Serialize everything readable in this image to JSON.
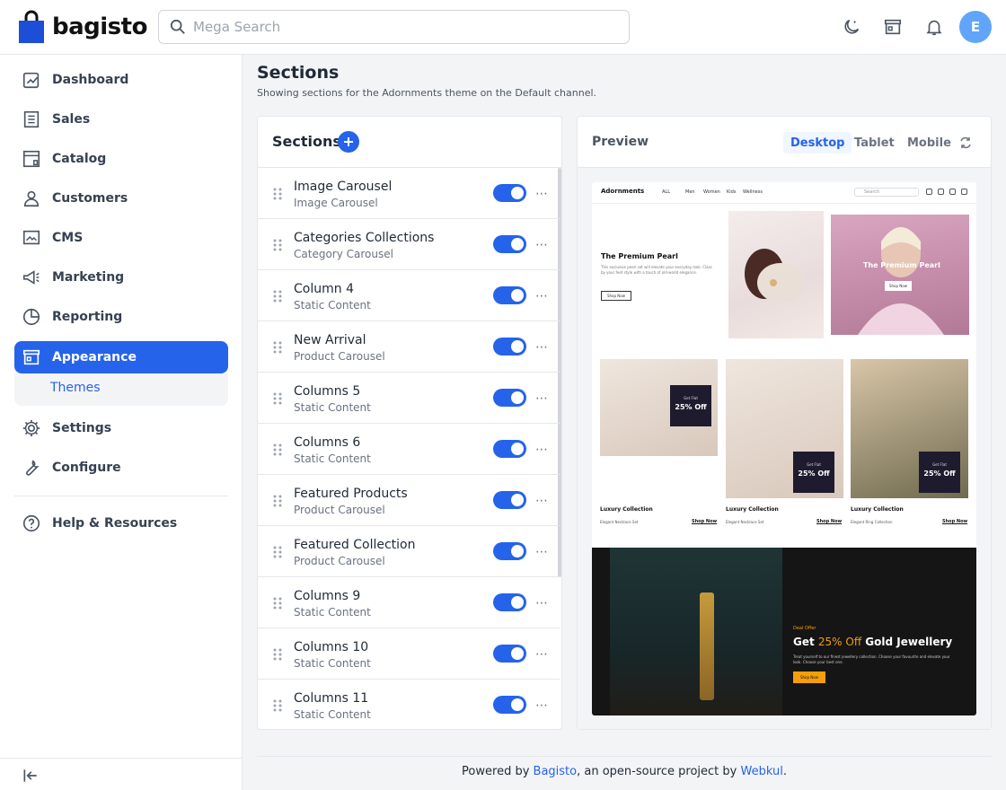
{
  "header": {
    "logo_text": "bagisto",
    "search_placeholder": "Mega Search",
    "avatar_letter": "E"
  },
  "sidebar": {
    "items": [
      {
        "label": "Dashboard",
        "icon": "dashboard-icon"
      },
      {
        "label": "Sales",
        "icon": "receipt-icon"
      },
      {
        "label": "Catalog",
        "icon": "catalog-icon"
      },
      {
        "label": "Customers",
        "icon": "user-icon"
      },
      {
        "label": "CMS",
        "icon": "cms-icon"
      },
      {
        "label": "Marketing",
        "icon": "megaphone-icon"
      },
      {
        "label": "Reporting",
        "icon": "pie-chart-icon"
      },
      {
        "label": "Appearance",
        "icon": "store-icon",
        "active": true
      },
      {
        "label": "Settings",
        "icon": "gear-icon"
      },
      {
        "label": "Configure",
        "icon": "wrench-icon"
      },
      {
        "label": "Help & Resources",
        "icon": "help-icon"
      }
    ],
    "subitem": "Themes"
  },
  "page": {
    "title": "Sections",
    "subtitle": "Showing sections for the Adornments theme on the Default channel."
  },
  "sections": {
    "title": "Sections",
    "rows": [
      {
        "name": "Image Carousel",
        "type": "Image Carousel"
      },
      {
        "name": "Categories Collections",
        "type": "Category Carousel"
      },
      {
        "name": "Column 4",
        "type": "Static Content"
      },
      {
        "name": "New Arrival",
        "type": "Product Carousel"
      },
      {
        "name": "Columns 5",
        "type": "Static Content"
      },
      {
        "name": "Columns 6",
        "type": "Static Content"
      },
      {
        "name": "Featured Products",
        "type": "Product Carousel"
      },
      {
        "name": "Featured Collection",
        "type": "Product Carousel"
      },
      {
        "name": "Columns 9",
        "type": "Static Content"
      },
      {
        "name": "Columns 10",
        "type": "Static Content"
      },
      {
        "name": "Columns 11",
        "type": "Static Content"
      }
    ]
  },
  "preview": {
    "title": "Preview",
    "tabs": [
      "Desktop",
      "Tablet",
      "Mobile"
    ],
    "active_tab": "Desktop",
    "frame": {
      "logo": "Adornments",
      "menu": [
        "ALL",
        "Men",
        "Women",
        "Kids",
        "Wellness"
      ],
      "search_placeholder": "Search",
      "hero_title": "The Premium Pearl",
      "hero_body": "This exclusive pearl set will elevate your everyday look. Class by your feet style with a touch of old-world elegance.",
      "hero_button": "Shop Now",
      "hero2_title": "The Premium Pearl",
      "hero2_button": "Shop Now",
      "cards": [
        {
          "badge_pre": "Get Flat",
          "badge_main": "25% Off",
          "title": "Luxury Collection",
          "sub": "Elegant Necklace Set",
          "link": "Shop Now"
        },
        {
          "badge_pre": "Get Flat",
          "badge_main": "25% Off",
          "title": "Luxury Collection",
          "sub": "Elegant Necklace Set",
          "link": "Shop Now"
        },
        {
          "badge_pre": "Get Flat",
          "badge_main": "25% Off",
          "title": "Luxury Collection",
          "sub": "Elegant Ring Collection",
          "link": "Shop Now"
        }
      ],
      "banner": {
        "pre": "Deal Offer",
        "title_a": "Get ",
        "title_hl": "25% Off",
        "title_b": " Gold Jewellery",
        "body": "Treat yourself to our finest jewellery collection. Choose your favourite and elevate your look. Choose your best one.",
        "button": "Shop Now"
      }
    }
  },
  "footer": {
    "prefix": "Powered by ",
    "link1": "Bagisto",
    "middle": ", an open-source project by ",
    "link2": "Webkul",
    "suffix": "."
  },
  "colors": {
    "primary": "#2563eb",
    "avatar": "#60a5fa",
    "accent_gold": "#f59e0b"
  }
}
